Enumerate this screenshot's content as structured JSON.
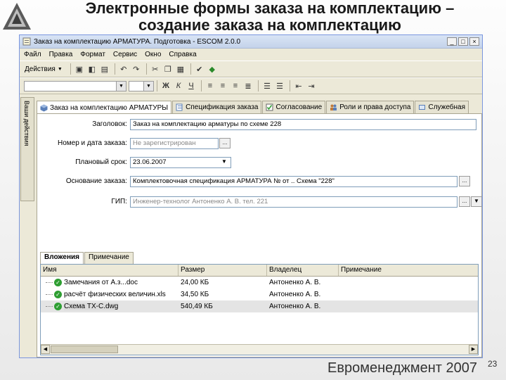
{
  "slide": {
    "title_line1": "Электронные формы заказа на комплектацию –",
    "title_line2": "создание заказа на комплектацию",
    "footer_brand": "Евроменеджмент 2007",
    "page_number": "23"
  },
  "window": {
    "title": "Заказ на комплектацию АРМАТУРА. Подготовка - ESCOM 2.0.0",
    "controls": {
      "minimize": "_",
      "maximize": "□",
      "close": "×"
    }
  },
  "menu": [
    "Файл",
    "Правка",
    "Формат",
    "Сервис",
    "Окно",
    "Справка"
  ],
  "toolbar": {
    "actions_label": "Действия",
    "icons": [
      "save-icon",
      "disk-icon",
      "print-icon",
      "undo-icon",
      "redo-icon",
      "cut-icon",
      "copy-icon",
      "paste-icon",
      "spellcheck-icon",
      "refresh-icon"
    ]
  },
  "format_toolbar": {
    "bold": "Ж",
    "italic": "К",
    "underline": "Ч",
    "icons": [
      "align-left-icon",
      "align-center-icon",
      "align-right-icon",
      "justify-icon",
      "numbered-list-icon",
      "bullet-list-icon",
      "outdent-icon",
      "indent-icon"
    ]
  },
  "sidebar": {
    "label": "Ваши действия"
  },
  "tabs": [
    {
      "label": "Заказ на комплектацию АРМАТУРЫ",
      "active": true,
      "icon": "cube-icon"
    },
    {
      "label": "Спецификация заказа",
      "active": false,
      "icon": "spec-icon"
    },
    {
      "label": "Согласование",
      "active": false,
      "icon": "approval-icon"
    },
    {
      "label": "Роли и права доступа",
      "active": false,
      "icon": "roles-icon"
    },
    {
      "label": "Служебная",
      "active": false,
      "icon": "service-icon"
    }
  ],
  "form": {
    "title_label": "Заголовок:",
    "title_value": "Заказ на комплектацию арматуры по схеме 228",
    "number_label": "Номер и дата заказа:",
    "number_value": "Не зарегистрирован",
    "deadline_label": "Плановый срок:",
    "deadline_value": "23.06.2007",
    "basis_label": "Основание заказа:",
    "basis_value": "Комплектовочная спецификация АРМАТУРА № от .. Схема \"228\"",
    "gip_label": "ГИП:",
    "gip_value": "Инженер-технолог Антоненко А. В. тел. 221",
    "dots": "..."
  },
  "subtabs": [
    {
      "label": "Вложения",
      "active": true
    },
    {
      "label": "Примечание",
      "active": false
    }
  ],
  "attachments": {
    "columns": [
      "Имя",
      "Размер",
      "Владелец",
      "Примечание"
    ],
    "rows": [
      {
        "name": "Замечания от А.з...doc",
        "size": "24,00 КБ",
        "owner": "Антоненко А. В.",
        "note": "",
        "selected": false
      },
      {
        "name": "расчёт физических величин.xls",
        "size": "34,50 КБ",
        "owner": "Антоненко А. В.",
        "note": "",
        "selected": false
      },
      {
        "name": "Схема ТХ-С.dwg",
        "size": "540,49 КБ",
        "owner": "Антоненко А. В.",
        "note": "",
        "selected": true
      }
    ]
  }
}
